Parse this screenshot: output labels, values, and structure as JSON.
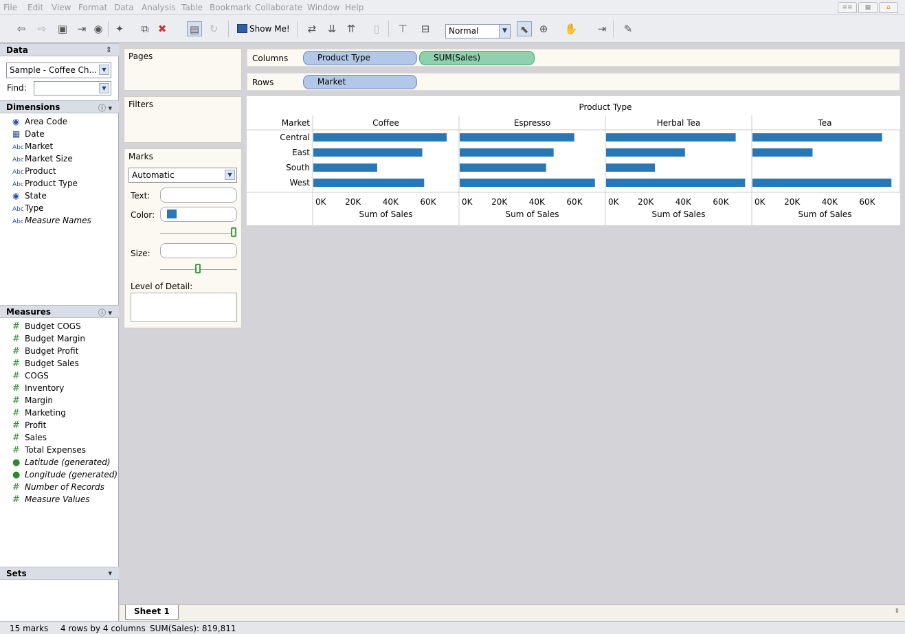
{
  "menu": [
    "File",
    "Edit",
    "View",
    "Format",
    "Data",
    "Analysis",
    "Table",
    "Bookmark",
    "Collaborate",
    "Window",
    "Help"
  ],
  "toolbar": {
    "show_me_label": "Show Me!",
    "fit_select": "Normal"
  },
  "data_pane": {
    "title": "Data",
    "datasource": "Sample - Coffee Ch...",
    "find_label": "Find:"
  },
  "dimensions": {
    "title": "Dimensions",
    "items": [
      {
        "label": "Area Code",
        "icon": "globe-icon"
      },
      {
        "label": "Date",
        "icon": "calendar-icon"
      },
      {
        "label": "Market",
        "icon": "abc-icon"
      },
      {
        "label": "Market Size",
        "icon": "abc-icon"
      },
      {
        "label": "Product",
        "icon": "abc-icon"
      },
      {
        "label": "Product Type",
        "icon": "abc-icon"
      },
      {
        "label": "State",
        "icon": "globe-icon"
      },
      {
        "label": "Type",
        "icon": "abc-icon"
      },
      {
        "label": "Measure Names",
        "icon": "abc-icon"
      }
    ]
  },
  "measures": {
    "title": "Measures",
    "items": [
      {
        "label": "Budget COGS"
      },
      {
        "label": "Budget Margin"
      },
      {
        "label": "Budget Profit"
      },
      {
        "label": "Budget Sales"
      },
      {
        "label": "COGS"
      },
      {
        "label": "Inventory"
      },
      {
        "label": "Margin"
      },
      {
        "label": "Marketing"
      },
      {
        "label": "Profit"
      },
      {
        "label": "Sales"
      },
      {
        "label": "Total Expenses"
      },
      {
        "label": "Latitude (generated)"
      },
      {
        "label": "Longitude (generated)"
      },
      {
        "label": "Number of Records"
      },
      {
        "label": "Measure Values"
      }
    ]
  },
  "sets": {
    "title": "Sets"
  },
  "cards": {
    "pages": "Pages",
    "filters": "Filters",
    "marks": "Marks",
    "mark_type": "Automatic",
    "text_label": "Text:",
    "color_label": "Color:",
    "size_label": "Size:",
    "lod_label": "Level of Detail:",
    "color_swatch": "#2878b8"
  },
  "shelves": {
    "columns_label": "Columns",
    "rows_label": "Rows",
    "column_pills": [
      "Product Type",
      "SUM(Sales)"
    ],
    "row_pills": [
      "Market"
    ]
  },
  "sheet_tab": "Sheet 1",
  "status": {
    "marks": "15 marks",
    "dims": "4 rows by 4 columns",
    "sum": "SUM(Sales): 819,811"
  },
  "chart_data": {
    "type": "bar",
    "title": "Product Type",
    "row_header": "Market",
    "categories": [
      "Central",
      "East",
      "South",
      "West"
    ],
    "panels": [
      {
        "name": "Coffee",
        "values": [
          71000,
          58000,
          34000,
          59000
        ]
      },
      {
        "name": "Espresso",
        "values": [
          61000,
          50000,
          46000,
          72000
        ]
      },
      {
        "name": "Herbal Tea",
        "values": [
          69000,
          42000,
          26000,
          74000
        ]
      },
      {
        "name": "Tea",
        "values": [
          69000,
          32000,
          null,
          74000
        ]
      }
    ],
    "xlabel": "Sum of Sales",
    "xticks": [
      "0K",
      "20K",
      "40K",
      "60K"
    ],
    "xlim": [
      0,
      75000
    ],
    "bar_color": "#2878b8"
  }
}
